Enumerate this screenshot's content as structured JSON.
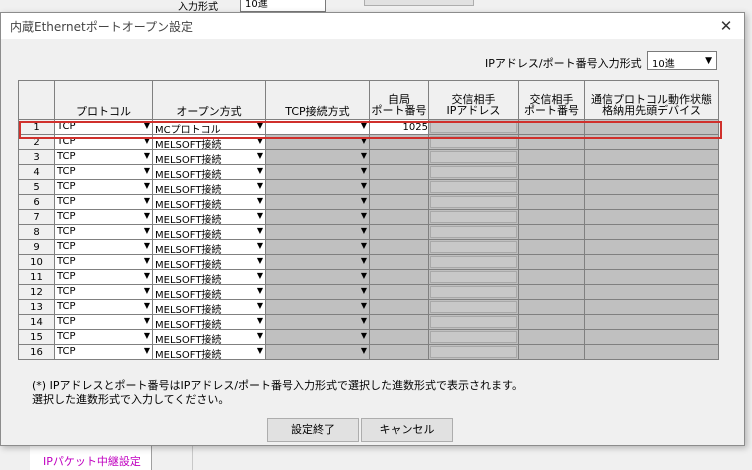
{
  "background": {
    "top_label": "入力形式",
    "top_select_value": "10進",
    "link_text": "IPパケット中継設定"
  },
  "dialog": {
    "title": "内蔵Ethernetポートオープン設定",
    "ip_format_label": "IPアドレス/ポート番号入力形式",
    "ip_format_value": "10進",
    "headers": {
      "protocol": "プロトコル",
      "open_method": "オープン方式",
      "tcp_method": "TCP接続方式",
      "own_port_1": "自局",
      "own_port_2": "ポート番号",
      "peer_ip_1": "交信相手",
      "peer_ip_2": "IPアドレス",
      "peer_port_1": "交信相手",
      "peer_port_2": "ポート番号",
      "device_1": "通信プロトコル動作状態",
      "device_2": "格納用先頭デバイス"
    },
    "rows": [
      {
        "no": "1",
        "protocol": "TCP",
        "open": "MCプロトコル",
        "port": "1025"
      },
      {
        "no": "2",
        "protocol": "TCP",
        "open": "MELSOFT接続",
        "port": ""
      },
      {
        "no": "3",
        "protocol": "TCP",
        "open": "MELSOFT接続",
        "port": ""
      },
      {
        "no": "4",
        "protocol": "TCP",
        "open": "MELSOFT接続",
        "port": ""
      },
      {
        "no": "5",
        "protocol": "TCP",
        "open": "MELSOFT接続",
        "port": ""
      },
      {
        "no": "6",
        "protocol": "TCP",
        "open": "MELSOFT接続",
        "port": ""
      },
      {
        "no": "7",
        "protocol": "TCP",
        "open": "MELSOFT接続",
        "port": ""
      },
      {
        "no": "8",
        "protocol": "TCP",
        "open": "MELSOFT接続",
        "port": ""
      },
      {
        "no": "9",
        "protocol": "TCP",
        "open": "MELSOFT接続",
        "port": ""
      },
      {
        "no": "10",
        "protocol": "TCP",
        "open": "MELSOFT接続",
        "port": ""
      },
      {
        "no": "11",
        "protocol": "TCP",
        "open": "MELSOFT接続",
        "port": ""
      },
      {
        "no": "12",
        "protocol": "TCP",
        "open": "MELSOFT接続",
        "port": ""
      },
      {
        "no": "13",
        "protocol": "TCP",
        "open": "MELSOFT接続",
        "port": ""
      },
      {
        "no": "14",
        "protocol": "TCP",
        "open": "MELSOFT接続",
        "port": ""
      },
      {
        "no": "15",
        "protocol": "TCP",
        "open": "MELSOFT接続",
        "port": ""
      },
      {
        "no": "16",
        "protocol": "TCP",
        "open": "MELSOFT接続",
        "port": ""
      }
    ],
    "note_line1": "(*) IPアドレスとポート番号はIPアドレス/ポート番号入力形式で選択した進数形式で表示されます。",
    "note_line2": "選択した進数形式で入力してください。",
    "ok_label": "設定終了",
    "cancel_label": "キャンセル",
    "highlight_color": "#d0302c"
  }
}
